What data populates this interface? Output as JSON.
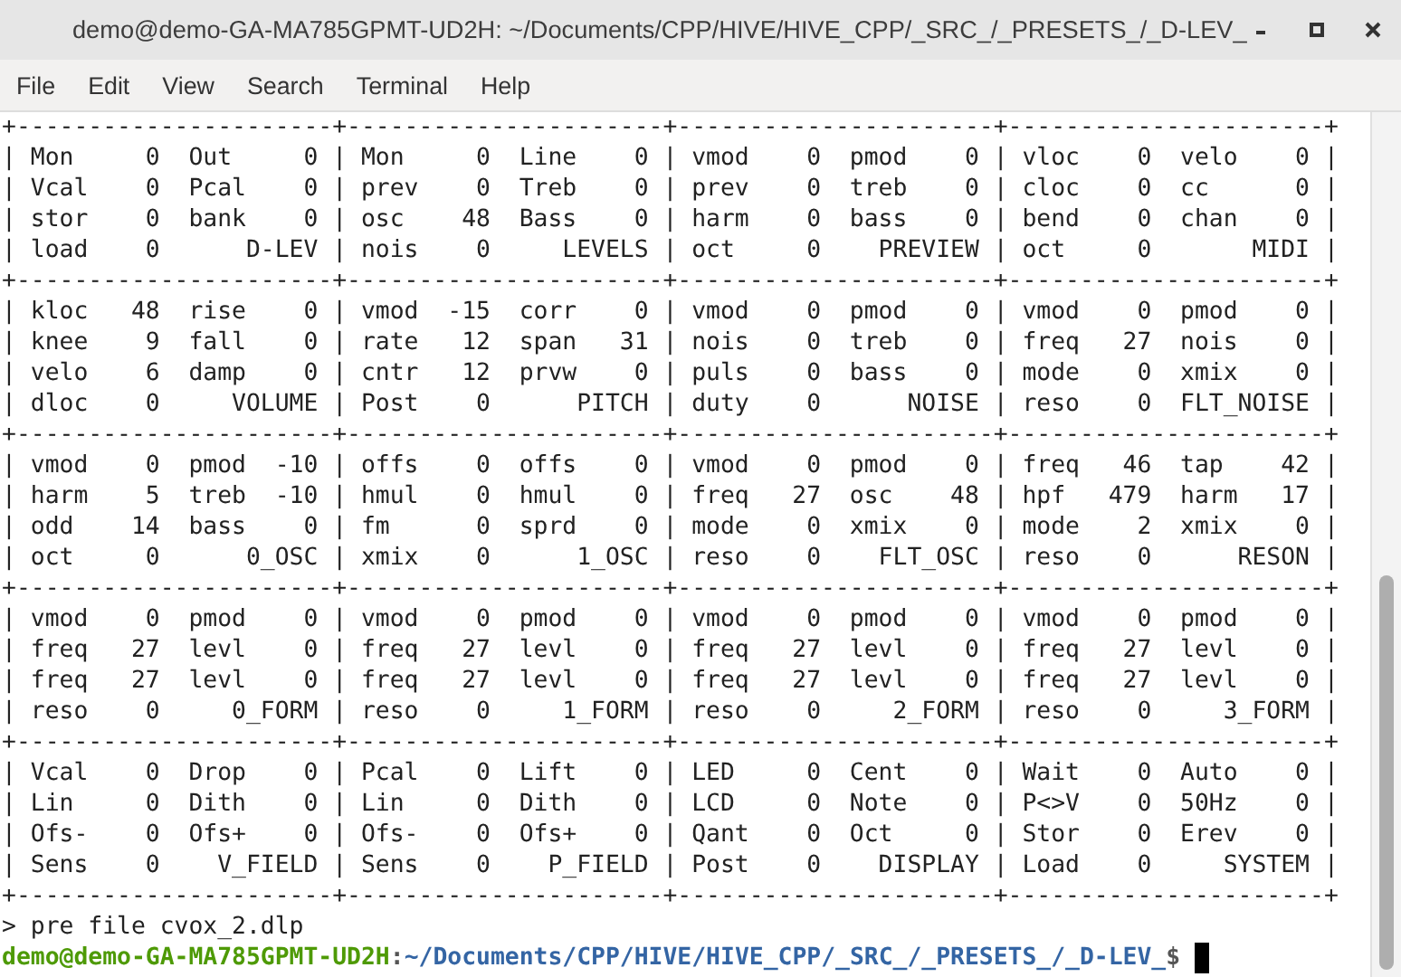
{
  "window": {
    "title": "demo@demo-GA-MA785GPMT-UD2H: ~/Documents/CPP/HIVE/HIVE_CPP/_SRC_/_PRESETS_/_D-LEV_"
  },
  "menu": [
    "File",
    "Edit",
    "View",
    "Search",
    "Terminal",
    "Help"
  ],
  "terminal": {
    "lines": [
      "+----------------------+----------------------+----------------------+----------------------+",
      "| Mon     0  Out     0 | Mon     0  Line    0 | vmod    0  pmod    0 | vloc    0  velo    0 |",
      "| Vcal    0  Pcal    0 | prev    0  Treb    0 | prev    0  treb    0 | cloc    0  cc      0 |",
      "| stor    0  bank    0 | osc    48  Bass    0 | harm    0  bass    0 | bend    0  chan    0 |",
      "| load    0      D-LEV | nois    0     LEVELS | oct     0    PREVIEW | oct     0       MIDI |",
      "+----------------------+----------------------+----------------------+----------------------+",
      "| kloc   48  rise    0 | vmod  -15  corr    0 | vmod    0  pmod    0 | vmod    0  pmod    0 |",
      "| knee    9  fall    0 | rate   12  span   31 | nois    0  treb    0 | freq   27  nois    0 |",
      "| velo    6  damp    0 | cntr   12  prvw    0 | puls    0  bass    0 | mode    0  xmix    0 |",
      "| dloc    0     VOLUME | Post    0      PITCH | duty    0      NOISE | reso    0  FLT_NOISE |",
      "+----------------------+----------------------+----------------------+----------------------+",
      "| vmod    0  pmod  -10 | offs    0  offs    0 | vmod    0  pmod    0 | freq   46  tap    42 |",
      "| harm    5  treb  -10 | hmul    0  hmul    0 | freq   27  osc    48 | hpf   479  harm   17 |",
      "| odd    14  bass    0 | fm      0  sprd    0 | mode    0  xmix    0 | mode    2  xmix    0 |",
      "| oct     0      0_OSC | xmix    0      1_OSC | reso    0    FLT_OSC | reso    0      RESON |",
      "+----------------------+----------------------+----------------------+----------------------+",
      "| vmod    0  pmod    0 | vmod    0  pmod    0 | vmod    0  pmod    0 | vmod    0  pmod    0 |",
      "| freq   27  levl    0 | freq   27  levl    0 | freq   27  levl    0 | freq   27  levl    0 |",
      "| freq   27  levl    0 | freq   27  levl    0 | freq   27  levl    0 | freq   27  levl    0 |",
      "| reso    0     0_FORM | reso    0     1_FORM | reso    0     2_FORM | reso    0     3_FORM |",
      "+----------------------+----------------------+----------------------+----------------------+",
      "| Vcal    0  Drop    0 | Pcal    0  Lift    0 | LED     0  Cent    0 | Wait    0  Auto    0 |",
      "| Lin     0  Dith    0 | Lin     0  Dith    0 | LCD     0  Note    0 | P<>V    0  50Hz    0 |",
      "| Ofs-    0  Ofs+    0 | Ofs-    0  Ofs+    0 | Qant    0  Oct     0 | Stor    0  Erev    0 |",
      "| Sens    0    V_FIELD | Sens    0    P_FIELD | Post    0    DISPLAY | Load    0     SYSTEM |",
      "+----------------------+----------------------+----------------------+----------------------+",
      "> pre file cvox_2.dlp"
    ],
    "prompt": {
      "user_host": "demo@demo-GA-MA785GPMT-UD2H",
      "separator": ":",
      "path": "~/Documents/CPP/HIVE/HIVE_CPP/_SRC_/_PRESETS_/_D-LEV_",
      "symbol": "$"
    }
  }
}
